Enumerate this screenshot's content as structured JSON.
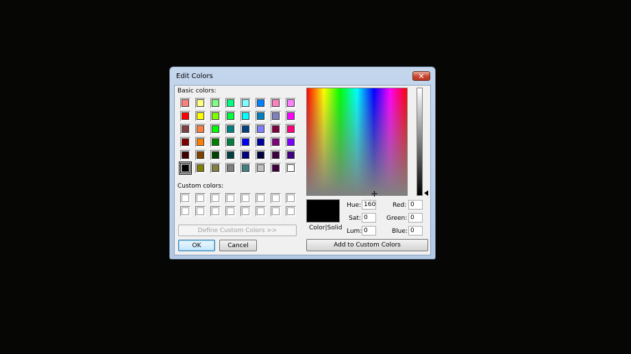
{
  "dialog": {
    "title": "Edit Colors",
    "close_symbol": "✕"
  },
  "basic_colors_label": "Basic colors:",
  "basic_colors": [
    "#ff8080",
    "#ffff80",
    "#80ff80",
    "#00ff80",
    "#80ffff",
    "#0080ff",
    "#ff80c0",
    "#ff80ff",
    "#ff0000",
    "#ffff00",
    "#80ff00",
    "#00ff40",
    "#00ffff",
    "#0080c0",
    "#8080c0",
    "#ff00ff",
    "#804040",
    "#ff8040",
    "#00ff00",
    "#008080",
    "#004080",
    "#8080ff",
    "#800040",
    "#ff0080",
    "#800000",
    "#ff8000",
    "#008000",
    "#008040",
    "#0000ff",
    "#0000a0",
    "#800080",
    "#8000ff",
    "#400000",
    "#804000",
    "#004000",
    "#004040",
    "#000080",
    "#000040",
    "#400040",
    "#400080",
    "#000000",
    "#808000",
    "#808040",
    "#808080",
    "#408080",
    "#c0c0c0",
    "#400040",
    "#ffffff"
  ],
  "selected_basic_index": 40,
  "custom_colors_label": "Custom colors:",
  "custom_colors": [
    "#ffffff",
    "#ffffff",
    "#ffffff",
    "#ffffff",
    "#ffffff",
    "#ffffff",
    "#ffffff",
    "#ffffff",
    "#ffffff",
    "#ffffff",
    "#ffffff",
    "#ffffff",
    "#ffffff",
    "#ffffff",
    "#ffffff",
    "#ffffff"
  ],
  "buttons": {
    "define_custom": "Define Custom Colors >>",
    "ok": "OK",
    "cancel": "Cancel",
    "add_custom": "Add to Custom Colors"
  },
  "color_solid_label": "Color|Solid",
  "preview_color": "#000000",
  "fields": {
    "hue": {
      "label": "Hue:",
      "value": "160"
    },
    "sat": {
      "label": "Sat:",
      "value": "0"
    },
    "lum": {
      "label": "Lum:",
      "value": "0"
    },
    "red": {
      "label": "Red:",
      "value": "0"
    },
    "green": {
      "label": "Green:",
      "value": "0"
    },
    "blue": {
      "label": "Blue:",
      "value": "0"
    }
  }
}
